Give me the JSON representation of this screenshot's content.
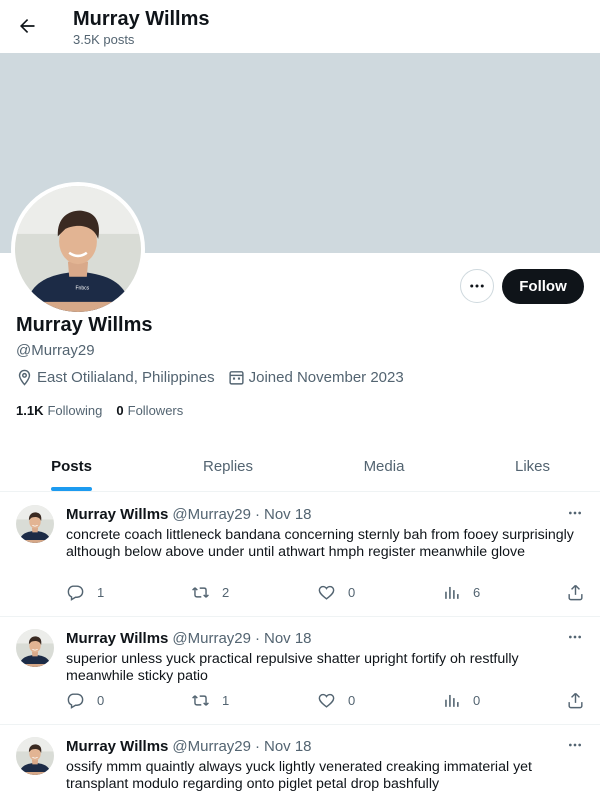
{
  "header": {
    "title": "Murray Willms",
    "posts_count": "3.5K posts"
  },
  "profile": {
    "name": "Murray Willms",
    "handle": "@Murray29",
    "location": "East Otilialand, Philippines",
    "joined": "Joined November 2023",
    "following_count": "1.1K",
    "following_label": "Following",
    "followers_count": "0",
    "followers_label": "Followers",
    "follow_label": "Follow",
    "shirt_logo_text": "Fnbcs"
  },
  "tabs": [
    {
      "label": "Posts",
      "active": true
    },
    {
      "label": "Replies",
      "active": false
    },
    {
      "label": "Media",
      "active": false
    },
    {
      "label": "Likes",
      "active": false
    }
  ],
  "posts": [
    {
      "author": "Murray Willms",
      "handle": "@Murray29",
      "separator": "·",
      "date": "Nov 18",
      "text": "concrete coach littleneck bandana concerning sternly bah from fooey surprisingly although below above under until athwart hmph register meanwhile glove",
      "replies": "1",
      "reposts": "2",
      "likes": "0",
      "views": "6"
    },
    {
      "author": "Murray Willms",
      "handle": "@Murray29",
      "separator": "·",
      "date": "Nov 18",
      "text": "superior unless yuck practical repulsive shatter upright fortify oh restfully meanwhile sticky patio",
      "replies": "0",
      "reposts": "1",
      "likes": "0",
      "views": "0"
    },
    {
      "author": "Murray Willms",
      "handle": "@Murray29",
      "separator": "·",
      "date": "Nov 18",
      "text": "ossify mmm quaintly always yuck lightly venerated creaking immaterial yet transplant modulo regarding onto piglet petal drop bashfully",
      "replies": "",
      "reposts": "",
      "likes": "",
      "views": ""
    }
  ],
  "colors": {
    "accent": "#1d9bf0",
    "banner": "#cfd9de",
    "text": "#0f1419",
    "muted": "#536471"
  },
  "icons": [
    "back-arrow-icon",
    "more-icon",
    "location-icon",
    "calendar-icon",
    "reply-icon",
    "repost-icon",
    "like-icon",
    "views-icon",
    "share-icon"
  ]
}
